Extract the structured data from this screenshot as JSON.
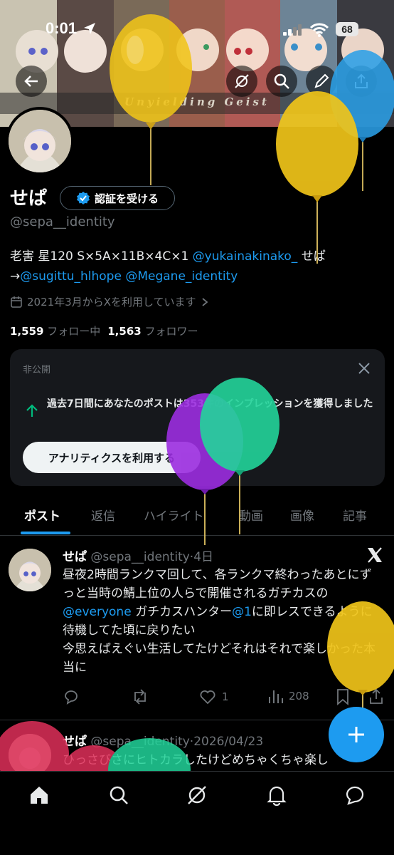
{
  "status_bar": {
    "time": "0:01",
    "battery": "68"
  },
  "banner": {
    "title": "Unyielding Geist"
  },
  "profile": {
    "name": "せぱ",
    "verify_button": "認証を受ける",
    "handle": "@sepa__identity",
    "bio_text_1": "老害 星120 S×5A×11B×4C×1 ",
    "bio_link_1": "@yukainakinako_",
    "bio_text_2": " せぱ",
    "bio_arrow": "→",
    "bio_link_2": "@sugittu_hlhope",
    "bio_link_3": "@Megane_identity",
    "joined": "2021年3月からXを利用しています",
    "following_count": "1,559",
    "following_label": "フォロー中",
    "followers_count": "1,563",
    "followers_label": "フォロワー"
  },
  "analytics_card": {
    "private_label": "非公開",
    "message": "過去7日間にあなたのポストは353件のインプレッションを獲得しました",
    "button": "アナリティクスを利用する"
  },
  "tabs": [
    "ポスト",
    "返信",
    "ハイライト",
    "動画",
    "画像",
    "記事"
  ],
  "posts": [
    {
      "name": "せぱ",
      "handle": "@sepa__identity",
      "time": "4日",
      "text_1": "昼夜2時間ランクマ回して、各ランクマ終わったあとにずっと当時の鯖上位の人らで開催されるガチカスの ",
      "mention_1": "@everyone",
      "text_2": " ガチカスハンター",
      "mention_2": "@1",
      "text_3": "に即レスできるように待機してた頃に戻りたい",
      "text_4": "今思えばえぐい生活してたけどそれはそれで楽しかった本当に",
      "likes": "1",
      "views": "208"
    },
    {
      "name": "せぱ",
      "handle": "@sepa__identity",
      "time": "2026/04/23",
      "text_1": "ひっさびさにヒトカラしたけどめちゃくちゃ楽し"
    }
  ],
  "colors": {
    "accent": "#1d9bf0",
    "background": "#000000",
    "card": "#16181c",
    "muted": "#71767b"
  }
}
